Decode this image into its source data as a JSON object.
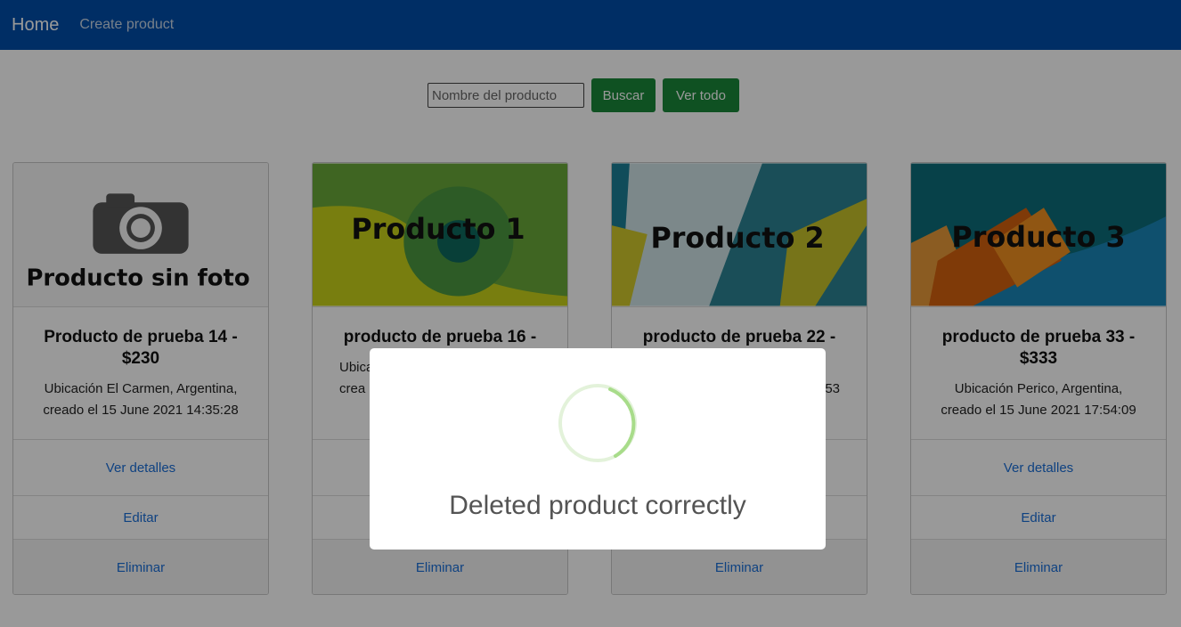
{
  "nav": {
    "brand": "Home",
    "create_link": "Create product"
  },
  "search": {
    "placeholder": "Nombre del producto",
    "value": "",
    "buscar_label": "Buscar",
    "ver_todo_label": "Ver todo"
  },
  "cards": [
    {
      "image_text": "Producto sin foto",
      "title": "Producto de prueba 14 - $230",
      "location": "Ubicación El Carmen, Argentina,",
      "created": "creado el 15 June 2021 14:35:28",
      "details_label": "Ver detalles",
      "edit_label": "Editar",
      "delete_label": "Eliminar"
    },
    {
      "image_text": "Producto 1",
      "title": "producto de prueba 16 -",
      "location": "Ubica",
      "created": "crea",
      "details_label": "",
      "edit_label": "",
      "delete_label": "Eliminar"
    },
    {
      "image_text": "Producto 2",
      "title": "producto de prueba 22 -",
      "location": "",
      "created": "53",
      "details_label": "",
      "edit_label": "",
      "delete_label": "Eliminar"
    },
    {
      "image_text": "Producto 3",
      "title": "producto de prueba 33 - $333",
      "location": "Ubicación Perico, Argentina,",
      "created": "creado el 15 June 2021 17:54:09",
      "details_label": "Ver detalles",
      "edit_label": "Editar",
      "delete_label": "Eliminar"
    }
  ],
  "modal": {
    "message": "Deleted product correctly",
    "icon": "loading-spinner-icon"
  },
  "colors": {
    "navbar": "#004ea9",
    "button_green": "#198739",
    "link_blue": "#1a6ed8"
  }
}
